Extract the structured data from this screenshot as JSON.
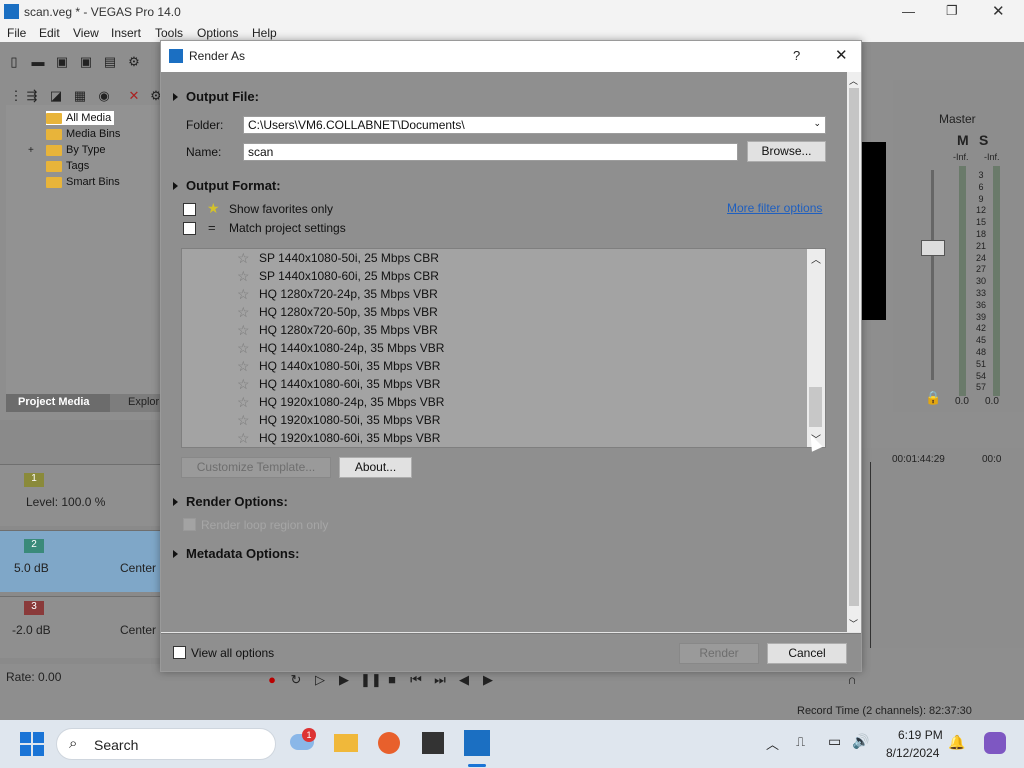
{
  "app": {
    "title": "scan.veg * - VEGAS Pro 14.0",
    "menu": [
      "File",
      "Edit",
      "View",
      "Insert",
      "Tools",
      "Options",
      "Help"
    ],
    "media_tree": [
      "All Media",
      "Media Bins",
      "By Type",
      "Tags",
      "Smart Bins"
    ],
    "panel_tabs": [
      "Project Media",
      "Explor"
    ],
    "time_display": "00",
    "tracks": [
      {
        "num": "1",
        "value": "Level: 100.0 %",
        "color": "#8a8a3a"
      },
      {
        "num": "2",
        "value": "5.0 dB",
        "pan": "Center",
        "color": "#3a8a7a"
      },
      {
        "num": "3",
        "value": "-2.0 dB",
        "pan": "Center",
        "color": "#8a3a3a"
      }
    ],
    "rate": "Rate: 0.00",
    "master": {
      "label": "Master",
      "m": "M",
      "s": "S",
      "inf_left": "-Inf.",
      "inf_right": "-Inf.",
      "val_left": "0.0",
      "val_right": "0.0",
      "scale": [
        "3",
        "6",
        "9",
        "12",
        "15",
        "18",
        "21",
        "24",
        "27",
        "30",
        "33",
        "36",
        "39",
        "42",
        "45",
        "48",
        "51",
        "54",
        "57"
      ]
    },
    "timeline_time": "00:01:44:29",
    "timeline_time2": "00:0",
    "record_time": "Record Time (2 channels): 82:37:30"
  },
  "dialog": {
    "title": "Render As",
    "help": "?",
    "close": "✕",
    "output_file": "Output File:",
    "folder_label": "Folder:",
    "folder_value": "C:\\Users\\VM6.COLLABNET\\Documents\\",
    "name_label": "Name:",
    "name_value": "scan",
    "browse": "Browse...",
    "output_format": "Output Format:",
    "show_favorites": "Show favorites only",
    "match_project": "Match project settings",
    "more_filter": "More filter options",
    "templates": [
      "SP 1440x1080-50i, 25 Mbps CBR",
      "SP 1440x1080-60i, 25 Mbps CBR",
      "HQ 1280x720-24p, 35 Mbps VBR",
      "HQ 1280x720-50p, 35 Mbps VBR",
      "HQ 1280x720-60p, 35 Mbps VBR",
      "HQ 1440x1080-24p, 35 Mbps VBR",
      "HQ 1440x1080-50i, 35 Mbps VBR",
      "HQ 1440x1080-60i, 35 Mbps VBR",
      "HQ 1920x1080-24p, 35 Mbps VBR",
      "HQ 1920x1080-50i, 35 Mbps VBR",
      "HQ 1920x1080-60i, 35 Mbps VBR"
    ],
    "customize": "Customize Template...",
    "about": "About...",
    "render_options": "Render Options:",
    "render_loop": "Render loop region only",
    "metadata_options": "Metadata Options:",
    "view_all": "View all options",
    "render": "Render",
    "cancel": "Cancel"
  },
  "taskbar": {
    "search": "Search",
    "time": "6:19 PM",
    "date": "8/12/2024",
    "weather_badge": "1"
  }
}
